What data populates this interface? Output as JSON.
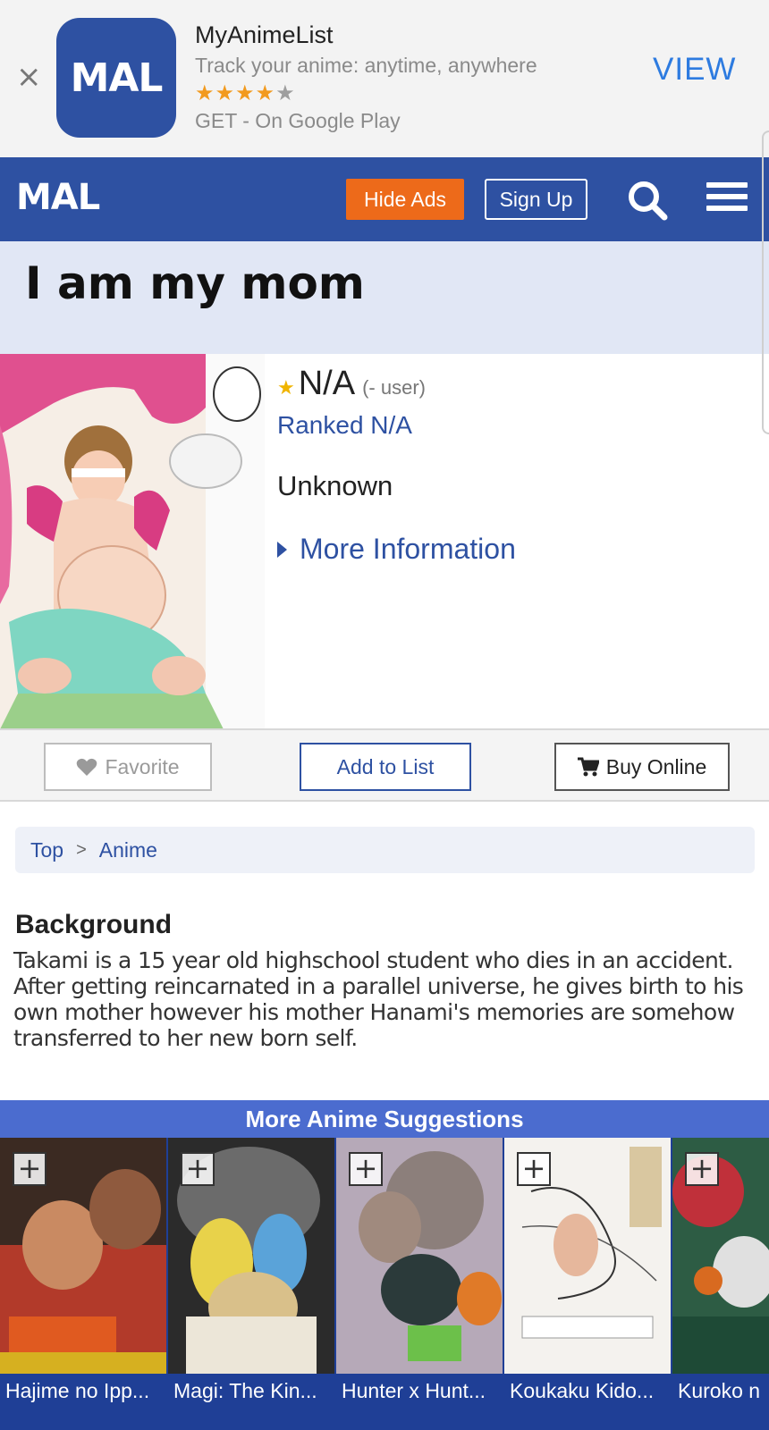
{
  "app_banner": {
    "close_glyph": "×",
    "icon_text": "MAL",
    "app_name": "MyAnimeList",
    "tagline": "Track your anime: anytime, anywhere",
    "rating_stars_filled": "★★★★",
    "rating_stars_empty": "★",
    "store_text": "GET - On Google Play",
    "view_label": "VIEW"
  },
  "header": {
    "logo": "MAL",
    "hide_ads_label": "Hide Ads",
    "signup_label": "Sign Up"
  },
  "title": "I am my mom",
  "info": {
    "score": "N/A",
    "score_users": "(- user)",
    "rank_prefix": "Ranked ",
    "rank_value": "N/A",
    "status": "Unknown",
    "more_info_label": "More Information"
  },
  "actions": {
    "favorite_label": "Favorite",
    "add_to_list_label": "Add to List",
    "buy_online_label": "Buy Online"
  },
  "breadcrumb": {
    "items": [
      "Top",
      "Anime"
    ],
    "separator": ">"
  },
  "background": {
    "heading": "Background",
    "text": "Takami is a 15 year old highschool student who dies in an accident. After getting reincarnated in a parallel universe, he gives birth to his own mother however his mother Hanami's memories are somehow transferred to her new born self."
  },
  "suggestions": {
    "heading": "More Anime Suggestions",
    "add_glyph": "+",
    "items": [
      {
        "title": "Hajime no Ipp..."
      },
      {
        "title": "Magi: The Kin..."
      },
      {
        "title": "Hunter x Hunt..."
      },
      {
        "title": "Koukaku Kido..."
      },
      {
        "title": "Kuroko n"
      }
    ]
  },
  "colors": {
    "brand_blue": "#2e51a2",
    "hide_ads_orange": "#ed6a1a",
    "view_blue": "#2d7be0",
    "title_band": "#e1e7f5",
    "suggestion_bar": "#4b6ccf"
  }
}
